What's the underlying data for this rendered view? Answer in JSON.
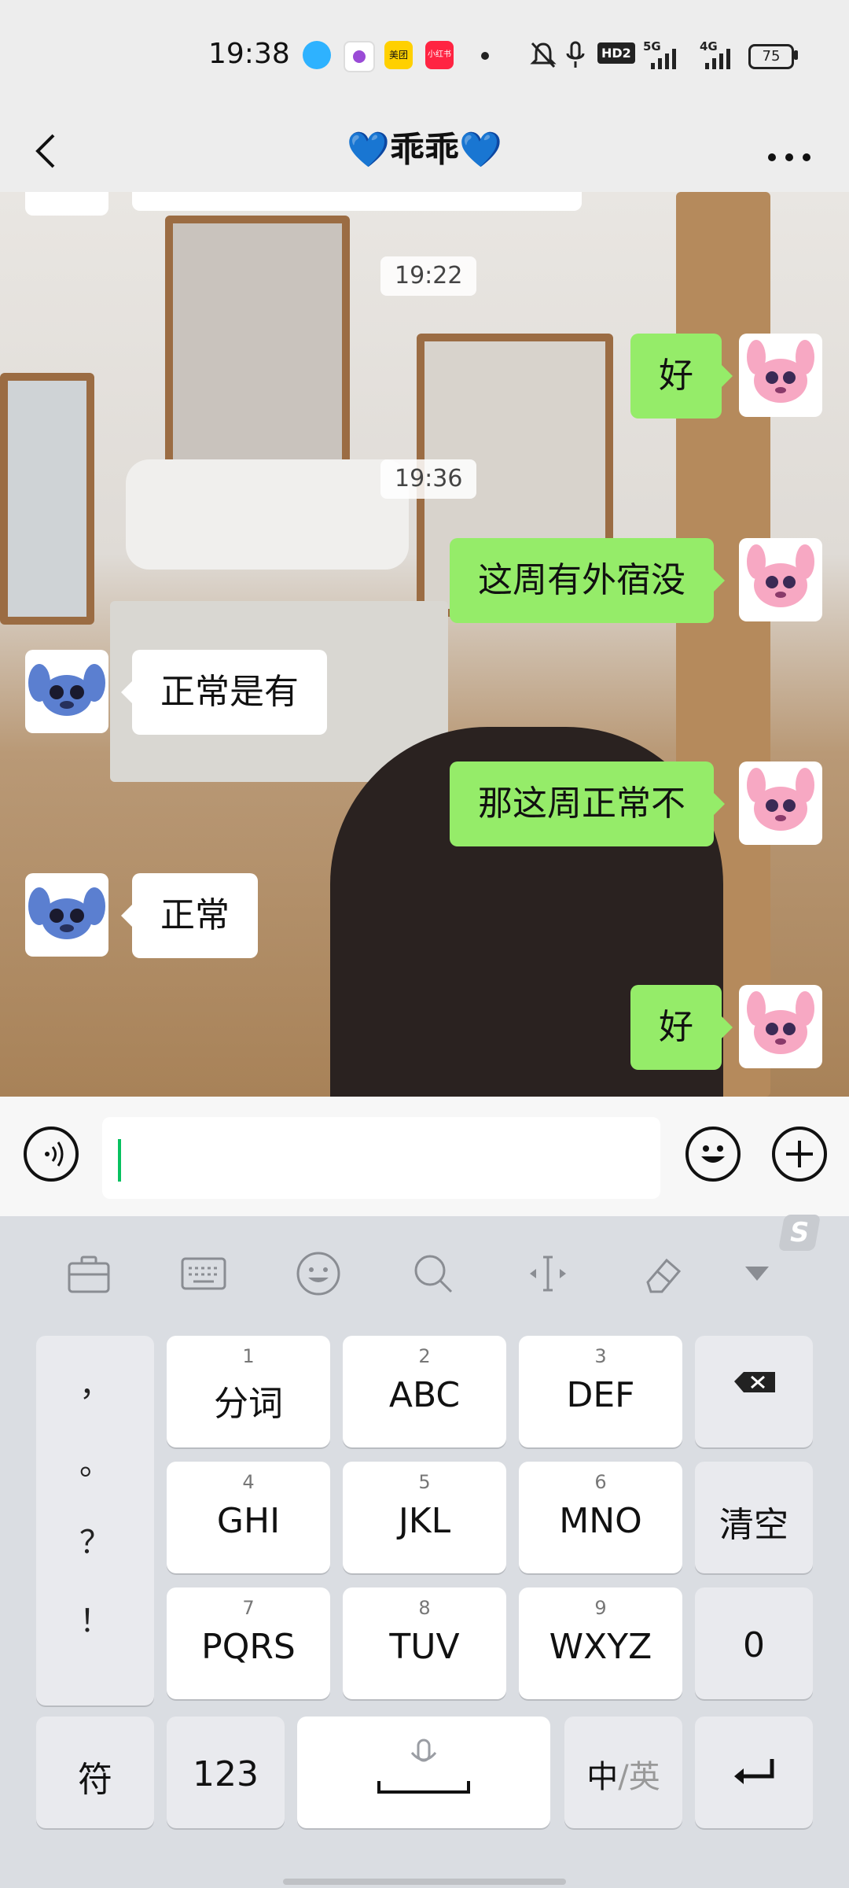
{
  "status_bar": {
    "time": "19:38",
    "apps": [
      {
        "name": "qq-icon",
        "label": ""
      },
      {
        "name": "app-icon-purple",
        "label": ""
      },
      {
        "name": "meituan-icon",
        "label": "美团"
      },
      {
        "name": "xiaohongshu-icon",
        "label": "小红书"
      }
    ],
    "network": "5G",
    "network2": "4G",
    "hd": "HD2",
    "battery": "75"
  },
  "nav": {
    "title": "乖乖",
    "heart": "💙"
  },
  "messages": [
    {
      "type": "timestamp",
      "text": "19:22"
    },
    {
      "type": "out",
      "text": "好"
    },
    {
      "type": "timestamp",
      "text": "19:36"
    },
    {
      "type": "out",
      "text": "这周有外宿没"
    },
    {
      "type": "in",
      "text": "正常是有"
    },
    {
      "type": "out",
      "text": "那这周正常不"
    },
    {
      "type": "in",
      "text": "正常"
    },
    {
      "type": "out",
      "text": "好"
    }
  ],
  "input": {
    "value": "",
    "placeholder": ""
  },
  "keyboard": {
    "toolbar": [
      "toolbox-icon",
      "keyboard-icon",
      "emoji-icon",
      "search-icon",
      "cursor-icon",
      "clear-format-icon",
      "collapse-icon"
    ],
    "punctuation": [
      "，",
      "。",
      "？",
      "！"
    ],
    "keys": [
      {
        "num": "1",
        "label": "分词"
      },
      {
        "num": "2",
        "label": "ABC"
      },
      {
        "num": "3",
        "label": "DEF"
      },
      {
        "num": "4",
        "label": "GHI"
      },
      {
        "num": "5",
        "label": "JKL"
      },
      {
        "num": "6",
        "label": "MNO"
      },
      {
        "num": "7",
        "label": "PQRS"
      },
      {
        "num": "8",
        "label": "TUV"
      },
      {
        "num": "9",
        "label": "WXYZ"
      }
    ],
    "clear": "清空",
    "zero": "0",
    "symbols": "符",
    "numbers": "123",
    "lang_zh": "中",
    "lang_sep": "/",
    "lang_en": "英"
  },
  "colors": {
    "out_bubble": "#95ec69",
    "in_bubble": "#ffffff",
    "accent": "#07c160"
  }
}
